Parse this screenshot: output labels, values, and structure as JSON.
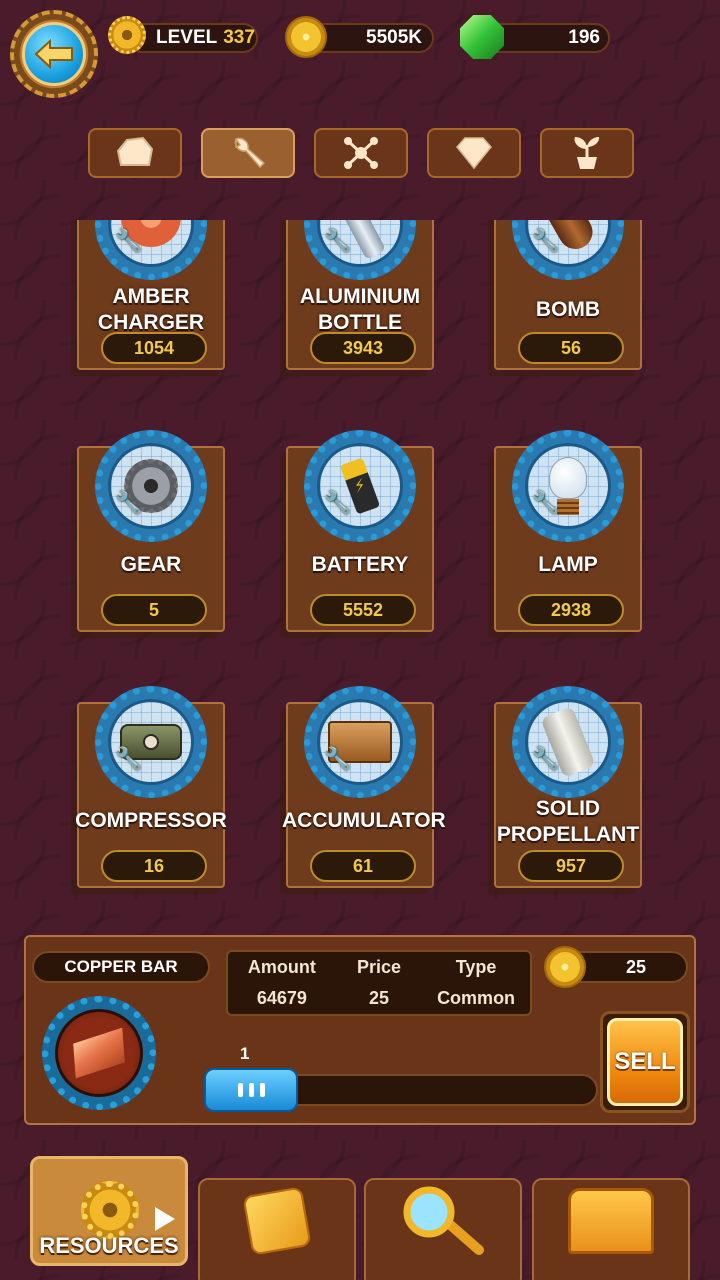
{
  "header": {
    "level_label": "LEVEL",
    "level_value": "337",
    "coins": "5505K",
    "gems": "196"
  },
  "tabs": [
    {
      "icon": "rock-icon",
      "active": false
    },
    {
      "icon": "wrench-icon",
      "active": true
    },
    {
      "icon": "molecule-icon",
      "active": false
    },
    {
      "icon": "diamond-icon",
      "active": false
    },
    {
      "icon": "sprout-icon",
      "active": false
    }
  ],
  "items": [
    {
      "name": "AMBER\nCHARGER",
      "count": "1054"
    },
    {
      "name": "ALUMINIUM\nBOTTLE",
      "count": "3943"
    },
    {
      "name": "BOMB",
      "count": "56"
    },
    {
      "name": "GEAR",
      "count": "5"
    },
    {
      "name": "BATTERY",
      "count": "5552"
    },
    {
      "name": "LAMP",
      "count": "2938"
    },
    {
      "name": "COMPRESSOR",
      "count": "16"
    },
    {
      "name": "ACCUMULATOR",
      "count": "61"
    },
    {
      "name": "SOLID\nPROPELLANT",
      "count": "957"
    }
  ],
  "detail": {
    "name": "COPPER BAR",
    "amount_label": "Amount",
    "amount_value": "64679",
    "price_label": "Price",
    "price_value": "25",
    "type_label": "Type",
    "type_value": "Common",
    "total_price": "25",
    "quantity": "1",
    "sell_label": "SELL"
  },
  "nav": {
    "resources_label": "RESOURCES"
  },
  "colors": {
    "background": "#4a1c2b",
    "card": "#6e3b1c",
    "accent_gold": "#f2c94c",
    "slider_blue": "#1a8ad8",
    "sell_orange": "#f08a10"
  }
}
